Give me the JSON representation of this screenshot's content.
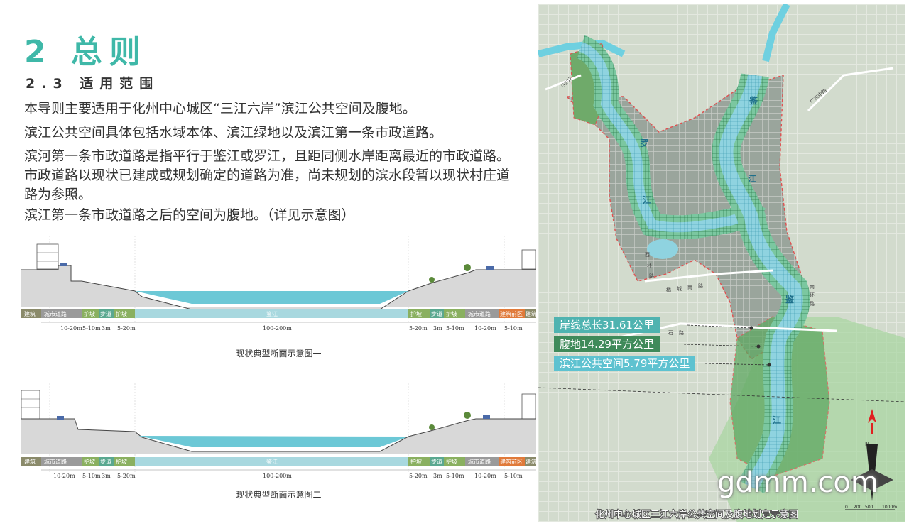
{
  "header": {
    "title": "2 总则",
    "subtitle": "2.3 适用范围"
  },
  "paragraphs": [
    "本导则主要适用于化州中心城区“三江六岸”滨江公共空间及腹地。",
    "滨江公共空间具体包括水域本体、滨江绿地以及滨江第一条市政道路。",
    "滨河第一条市政道路是指平行于鉴江或罗江，且距同侧水岸距离最近的市政道路。市政道路以现状已建成或规划确定的道路为准，尚未规划的滨水段暂以现状村庄道路为参照。",
    "滨江第一条市政道路之后的空间为腹地。（详见示意图）"
  ],
  "section1": {
    "caption": "现状典型断面示意图一",
    "zones": [
      "建筑",
      "城市道路",
      "护坡",
      "步道",
      "护坡",
      "鉴江",
      "护坡",
      "步道",
      "护坡",
      "城市道路",
      "建筑前区",
      "建筑"
    ],
    "dims": [
      "10-20m",
      "5-10m",
      "3m",
      "5-20m",
      "100-200m",
      "5-20m",
      "3m",
      "5-10m",
      "10-20m",
      "5-10m"
    ]
  },
  "section2": {
    "caption": "现状典型断面示意图二",
    "zones": [
      "建筑",
      "城市道路",
      "护坡",
      "步道",
      "护坡",
      "鉴江",
      "护坡",
      "步道",
      "护坡",
      "城市道路",
      "建筑前区",
      "建筑"
    ],
    "dims": [
      "10-20m",
      "5-10m",
      "3m",
      "5-20m",
      "100-200m",
      "5-20m",
      "3m",
      "5-10m",
      "10-20m",
      "5-10m"
    ]
  },
  "map": {
    "labels": {
      "shoreline": "岸线总长31.61公里",
      "hinterland": "腹地14.29平方公里",
      "public_space": "滨江公共空间5.79平方公里"
    },
    "river_names": [
      "罗",
      "江",
      "鉴",
      "江",
      "鉴",
      "江"
    ],
    "road_names": [
      "G207",
      "广东中路",
      "西",
      "环",
      "路",
      "橘",
      "城",
      "南",
      "路",
      "南",
      "环",
      "路",
      "石",
      "路"
    ],
    "bottom_caption": "化州中心城区三江六岸公共空间及腹地划定示意图",
    "scale": [
      "0",
      "200",
      "500",
      "1000m"
    ],
    "north": "N"
  },
  "watermark": "gdmm.com",
  "colors": {
    "title": "#3fb8a8",
    "water": "#6cc8d6",
    "label_teal": "#4fb3b0",
    "label_green": "#3f8a5a",
    "label_cyan": "#5ec2d0"
  }
}
